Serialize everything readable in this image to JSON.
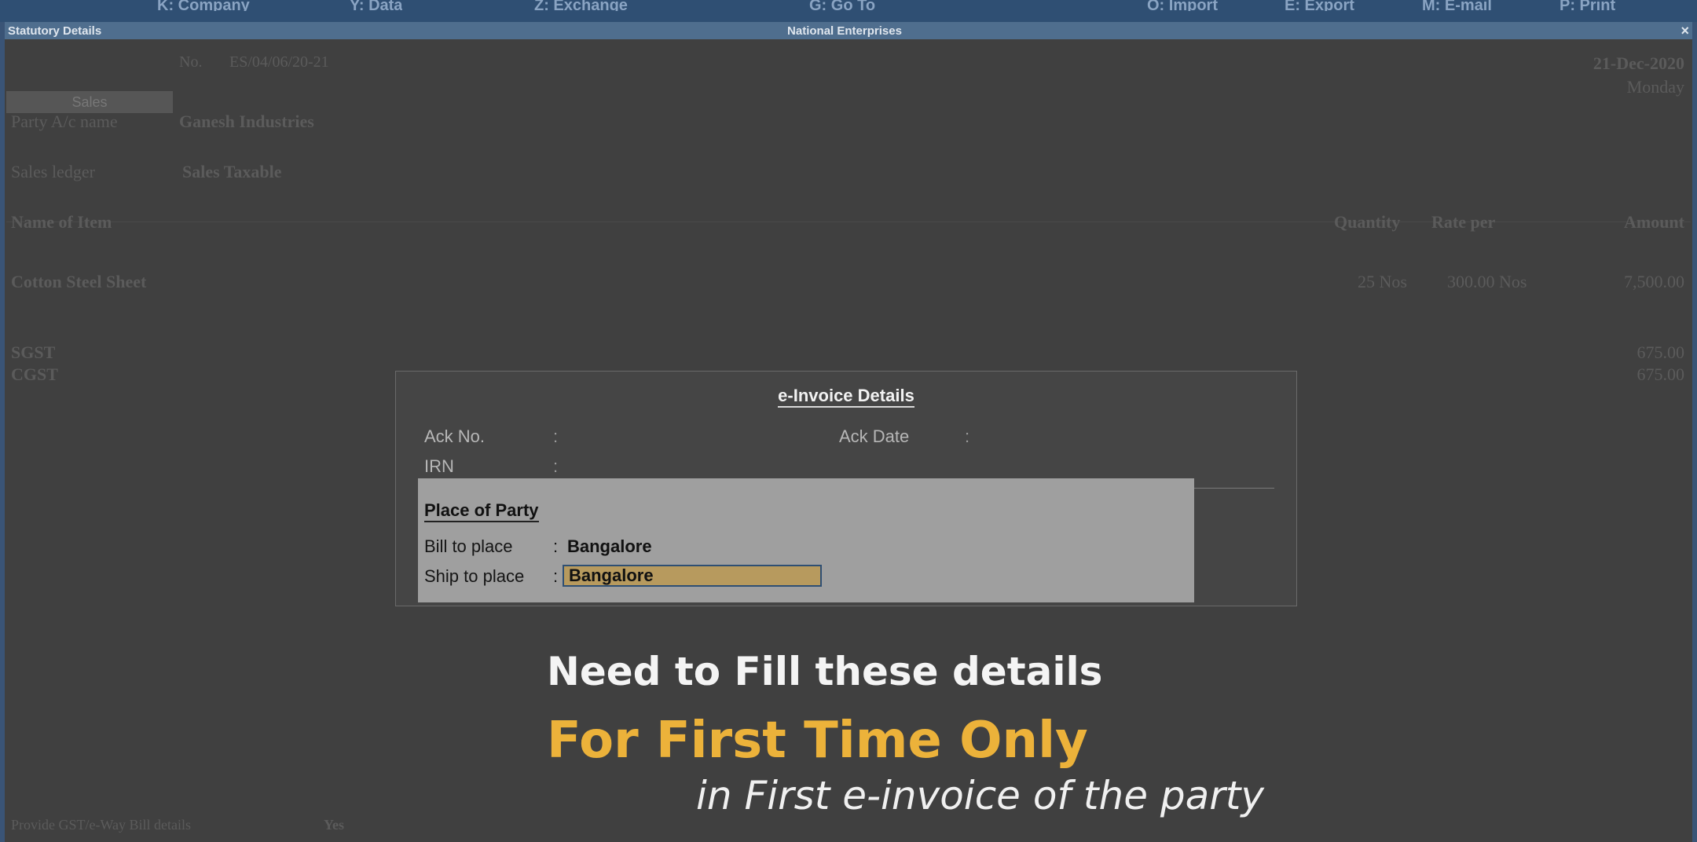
{
  "top_menu": [
    "K: Company",
    "Y: Data",
    "Z: Exchange",
    "G: Go To",
    "O: Import",
    "E: Export",
    "M: E-mail",
    "P: Print"
  ],
  "window": {
    "title": "Statutory Details",
    "company": "National Enterprises",
    "close": "×"
  },
  "voucher": {
    "type_label": "Sales",
    "no_label": "No.",
    "number": "ES/04/06/20-21",
    "date": "21-Dec-2020",
    "day": "Monday",
    "party_label": "Party A/c name",
    "party_value": "Ganesh Industries",
    "ledger_label": "Sales ledger",
    "ledger_value": "Sales Taxable",
    "col_item": "Name of Item",
    "col_qty": "Quantity",
    "col_rate": "Rate per",
    "col_amount": "Amount",
    "item_name": "Cotton Steel Sheet",
    "item_qty": "25 Nos",
    "item_rate": "300.00 Nos",
    "item_amount": "7,500.00",
    "tax1_label": "SGST",
    "tax1_amount": "675.00",
    "tax2_label": "CGST",
    "tax2_amount": "675.00",
    "bottom_label": "Provide GST/e-Way Bill details",
    "bottom_value": "Yes"
  },
  "dialog": {
    "title": "e-Invoice Details",
    "ack_no_label": "Ack No.",
    "ack_date_label": "Ack Date",
    "irn_label": "IRN",
    "colon": ":",
    "section_title": "Place of Party",
    "bill_label": "Bill to place",
    "bill_value": "Bangalore",
    "ship_label": "Ship to place",
    "ship_value": "Bangalore"
  },
  "caption": {
    "line1": "Need to Fill these details",
    "line2": "For First Time Only",
    "line3": "in First e-invoice of the party"
  },
  "colors": {
    "accent": "#ecb23a",
    "titlebar": "#4f6e8e",
    "field_focus": "#b79a5e"
  }
}
